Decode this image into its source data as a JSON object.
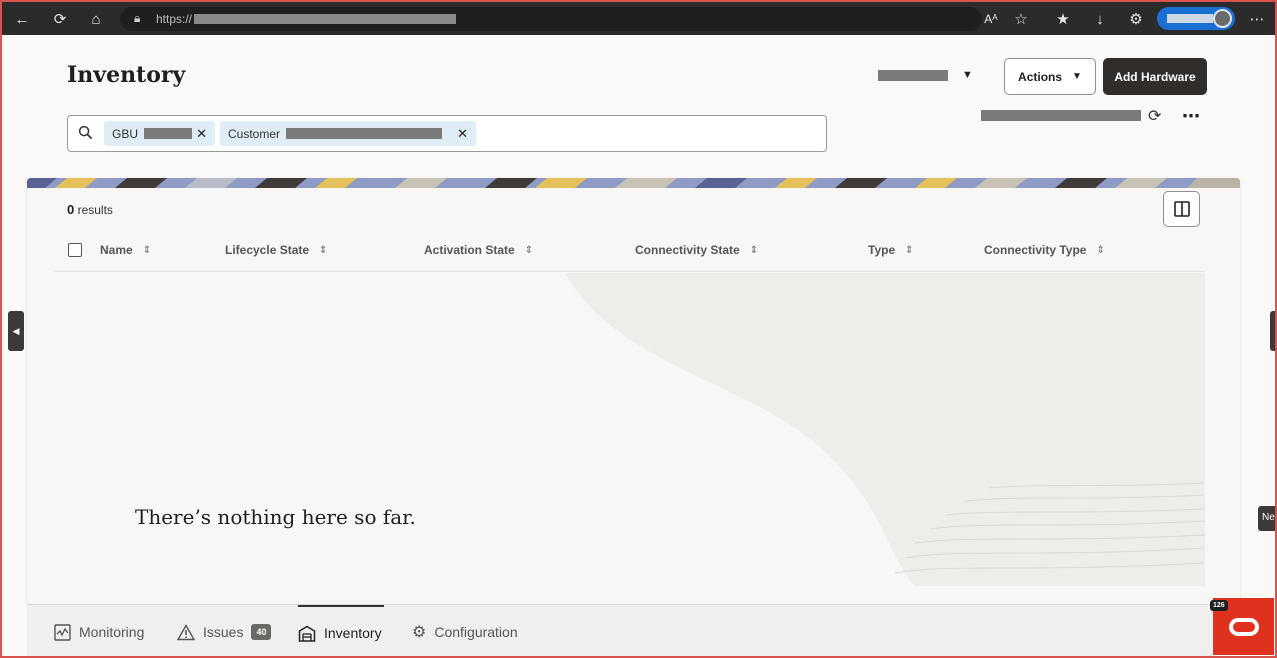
{
  "browser": {
    "url_prefix": "https://",
    "text_size_label": "Aᴬ"
  },
  "header": {
    "title": "Inventory",
    "actions_label": "Actions",
    "add_hardware_label": "Add Hardware"
  },
  "filters": {
    "chips": [
      {
        "label": "GBU"
      },
      {
        "label": "Customer"
      }
    ]
  },
  "results": {
    "count": "0",
    "suffix": "results",
    "columns": [
      "Name",
      "Lifecycle State",
      "Activation State",
      "Connectivity State",
      "Type",
      "Connectivity Type"
    ],
    "empty_message": "There’s nothing here so far."
  },
  "bottom_nav": {
    "items": [
      {
        "label": "Monitoring",
        "icon": "monitoring-icon"
      },
      {
        "label": "Issues",
        "icon": "warning-icon",
        "badge": "40"
      },
      {
        "label": "Inventory",
        "icon": "inventory-icon",
        "active": true
      },
      {
        "label": "Configuration",
        "icon": "gear-icon"
      }
    ]
  },
  "side_tab": {
    "label": "Ne"
  },
  "assistant": {
    "count": "126"
  },
  "colors": {
    "primary_button": "#312d2a",
    "chip_bg": "#dfeef6",
    "assistant_red": "#e0301e",
    "browser_bar": "#2b2b2b",
    "profile_blue": "#1a6fd4"
  }
}
